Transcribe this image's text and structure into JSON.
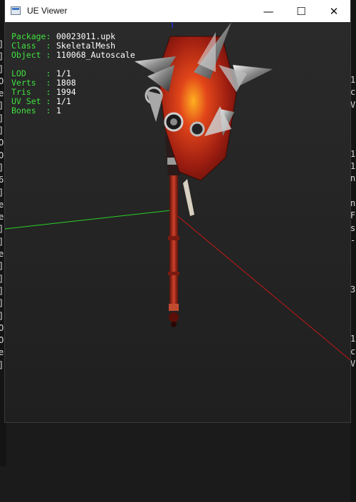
{
  "window": {
    "title": "UE Viewer",
    "controls": {
      "minimize": "—",
      "maximize": "☐",
      "close": "✕"
    }
  },
  "info": {
    "package": {
      "label": "Package:",
      "value": "00023011.upk"
    },
    "class": {
      "label": "Class  :",
      "value": "SkeletalMesh"
    },
    "object": {
      "label": "Object :",
      "value": "110068_Autoscale"
    },
    "lod": {
      "label": "LOD    :",
      "value": "1/1"
    },
    "verts": {
      "label": "Verts  :",
      "value": "1808"
    },
    "tris": {
      "label": "Tris   :",
      "value": "1994"
    },
    "uvset": {
      "label": "UV Set :",
      "value": "1/1"
    },
    "bones": {
      "label": "Bones  :",
      "value": "1"
    }
  },
  "background_console": {
    "left_chars": [
      "]",
      "]",
      "]",
      "O",
      "e",
      "]",
      "]",
      "]",
      "O",
      "O",
      "]",
      "6",
      "]",
      "e",
      "e",
      "]",
      "]",
      "e",
      "]",
      "]",
      "]",
      "]",
      "]",
      "O",
      "O",
      "e",
      "]"
    ],
    "right_chars": [
      "1",
      "c",
      "V",
      "",
      "",
      "",
      "1",
      "1",
      "n",
      "",
      "n",
      "F",
      "s",
      "-",
      "",
      "",
      "",
      "3",
      "",
      "",
      "",
      "1",
      "c",
      "V"
    ]
  },
  "colors": {
    "axis_x": "#c41818",
    "axis_y": "#2bd02b",
    "axis_z": "#2030d8",
    "info_label": "#3fe03f",
    "info_value": "#ffffff"
  }
}
